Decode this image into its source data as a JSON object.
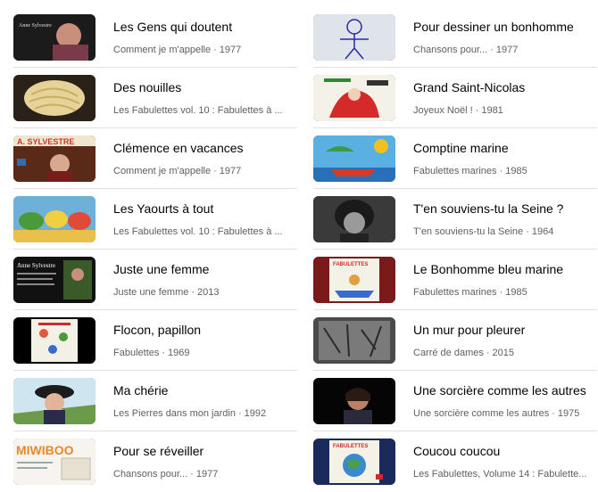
{
  "left_column": [
    {
      "title": "Les Gens qui doutent",
      "album": "Comment je m'appelle",
      "year": "1977",
      "thumb_icon": "portrait-thumbnail",
      "thumb_text": "Anne Sylvestre"
    },
    {
      "title": "Des nouilles",
      "album": "Les Fabulettes vol. 10 : Fabulettes à ...",
      "year": "",
      "thumb_icon": "noodles-thumbnail",
      "thumb_text": ""
    },
    {
      "title": "Clémence en vacances",
      "album": "Comment je m'appelle",
      "year": "1977",
      "thumb_icon": "singer-tv-thumbnail",
      "thumb_text": "A. SYLVESTRE"
    },
    {
      "title": "Les Yaourts à tout",
      "album": "Les Fabulettes vol. 10 : Fabulettes à ...",
      "year": "",
      "thumb_icon": "cartoon-illustration-thumbnail",
      "thumb_text": ""
    },
    {
      "title": "Juste une femme",
      "album": "Juste une femme",
      "year": "2013",
      "thumb_icon": "concert-poster-thumbnail",
      "thumb_text": "Anne Sylvestre"
    },
    {
      "title": "Flocon, papillon",
      "album": "Fabulettes",
      "year": "1969",
      "thumb_icon": "album-cover-thumbnail",
      "thumb_text": ""
    },
    {
      "title": "Ma chérie",
      "album": "Les Pierres dans mon jardin",
      "year": "1992",
      "thumb_icon": "woman-hat-thumbnail",
      "thumb_text": ""
    },
    {
      "title": "Pour se réveiller",
      "album": "Chansons pour...",
      "year": "1977",
      "thumb_icon": "miwiboo-thumbnail",
      "thumb_text": "MIWIBOO"
    }
  ],
  "right_column": [
    {
      "title": "Pour dessiner un bonhomme",
      "album": "Chansons pour...",
      "year": "1977",
      "thumb_icon": "stick-figure-drawing-thumbnail",
      "thumb_text": ""
    },
    {
      "title": "Grand Saint-Nicolas",
      "album": "Joyeux Noël !",
      "year": "1981",
      "thumb_icon": "saint-nicolas-cover-thumbnail",
      "thumb_text": ""
    },
    {
      "title": "Comptine marine",
      "album": "Fabulettes marines",
      "year": "1985",
      "thumb_icon": "boat-illustration-thumbnail",
      "thumb_text": ""
    },
    {
      "title": "T'en souviens-tu la Seine ?",
      "album": "T'en souviens-tu la Seine",
      "year": "1964",
      "thumb_icon": "bw-portrait-thumbnail",
      "thumb_text": ""
    },
    {
      "title": "Le Bonhomme bleu marine",
      "album": "Fabulettes marines",
      "year": "1985",
      "thumb_icon": "fabulettes-cover-thumbnail",
      "thumb_text": "FABULETTES"
    },
    {
      "title": "Un mur pour pleurer",
      "album": "Carré de dames",
      "year": "2015",
      "thumb_icon": "graffiti-wall-thumbnail",
      "thumb_text": ""
    },
    {
      "title": "Une sorcière comme les autres",
      "album": "Une sorcière comme les autres",
      "year": "1975",
      "thumb_icon": "singer-stage-thumbnail",
      "thumb_text": ""
    },
    {
      "title": "Coucou coucou",
      "album": "Les Fabulettes, Volume 14 : Fabulette...",
      "year": "",
      "thumb_icon": "fabulettes-globe-cover-thumbnail",
      "thumb_text": "FABULETTES"
    }
  ],
  "separator": "·",
  "colors": {
    "title": "#030303",
    "subtitle": "#606060",
    "divider": "#e0e0e0"
  }
}
